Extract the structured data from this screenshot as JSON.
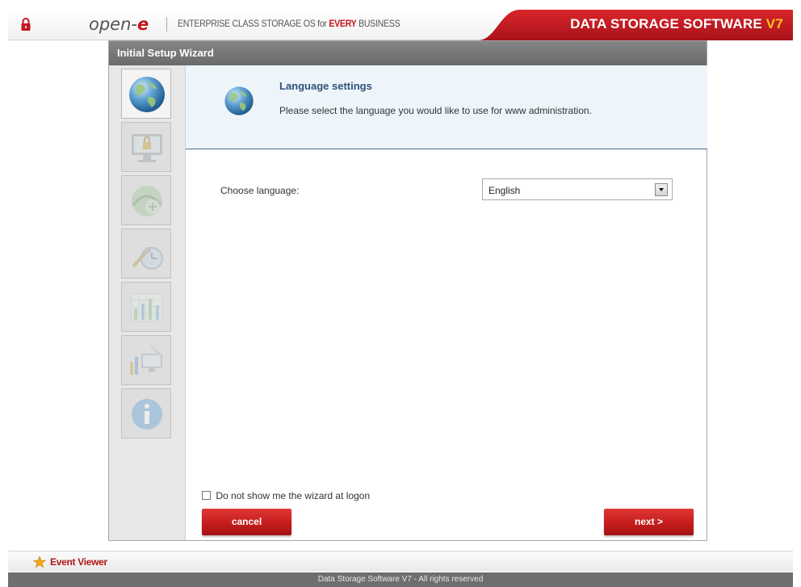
{
  "header": {
    "logo_prefix": "open-",
    "logo_suffix": "e",
    "tagline_prefix": "ENTERPRISE CLASS STORAGE OS for",
    "tagline_highlight": "EVERY",
    "tagline_suffix": "BUSINESS",
    "brand_text": "DATA STORAGE SOFTWARE",
    "brand_version": "V7",
    "lock_icon": "lock-icon",
    "brand_color": "#c4161c",
    "version_color": "#ffc21a"
  },
  "wizard": {
    "title": "Initial Setup Wizard",
    "steps": [
      {
        "icon": "globe-icon",
        "state": "active"
      },
      {
        "icon": "monitor-lock-icon",
        "state": "inactive"
      },
      {
        "icon": "network-icon",
        "state": "inactive"
      },
      {
        "icon": "clock-tools-icon",
        "state": "inactive"
      },
      {
        "icon": "grid-chart-icon",
        "state": "inactive"
      },
      {
        "icon": "computer-chart-icon",
        "state": "inactive"
      },
      {
        "icon": "info-icon",
        "state": "inactive"
      }
    ],
    "section": {
      "icon": "globe-icon",
      "title": "Language settings",
      "description": "Please select the language you would like to use for www administration."
    },
    "language_label": "Choose language:",
    "language_value": "English",
    "dont_show_label": "Do not show me the wizard at logon",
    "dont_show_checked": false,
    "cancel_label": "cancel",
    "next_label": "next >"
  },
  "bottom": {
    "event_viewer_label": "Event Viewer",
    "event_viewer_icon": "star-icon",
    "footer_text": "Data Storage Software V7 - All rights reserved"
  }
}
